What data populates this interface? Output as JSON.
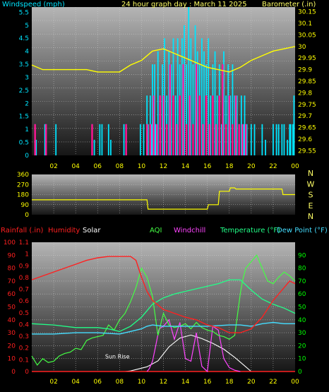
{
  "colors": {
    "wind": "#00e5ff",
    "gust": "#ff1493",
    "barometer": "#ffff00",
    "dir": "#ffff00",
    "rain": "#ff2020",
    "humidity": "#ff2020",
    "solar": "#ffffff",
    "aqi": "#44ff44",
    "windchill": "#ff44ff",
    "temperature": "#22ff88",
    "dewpoint": "#44ddff",
    "green_text": "#00ff00",
    "title_text": "#ffff66"
  },
  "header": {
    "windspeed_label": "Windspeed (mph)",
    "title": "24 hour graph day : March 11 2025",
    "barometer_label": "Barometer (.in)"
  },
  "legend": {
    "rainfall": "Rainfall (.in)",
    "humidity": "Humidity",
    "solar": "Solar",
    "aqi": "AQI",
    "windchill": "Windchill",
    "temperature": "Temperature (°F)",
    "dewpoint": "Dew Point (°F)"
  },
  "chart_data": [
    {
      "type": "bar",
      "title": "24 hour graph day : March 11 2025",
      "ylabel": "Windspeed (mph)",
      "y2label": "Barometer (.in)",
      "ylim": [
        0,
        5.7
      ],
      "y2lim": [
        29.53,
        30.17
      ],
      "x_ticks": [
        "02",
        "04",
        "06",
        "08",
        "10",
        "12",
        "14",
        "16",
        "18",
        "20",
        "22",
        "00"
      ],
      "y_ticks": [
        "0",
        "0.5",
        "1",
        "1.5",
        "2",
        "2.5",
        "3",
        "3.5",
        "4",
        "4.5",
        "5",
        "5.5"
      ],
      "y2_ticks": [
        "29.55",
        "29.6",
        "29.65",
        "29.7",
        "29.75",
        "29.8",
        "29.85",
        "29.9",
        "29.95",
        "30",
        "30.05",
        "30.1",
        "30.15"
      ],
      "series": [
        {
          "name": "Windspeed",
          "x": [
            0.3,
            0.4,
            1.2,
            1.3,
            2.2,
            5.5,
            5.7,
            6.2,
            6.4,
            7.0,
            7.2,
            8.4,
            8.6,
            9.9,
            10.2,
            10.5,
            10.6,
            10.8,
            10.9,
            11.0,
            11.2,
            11.3,
            11.5,
            11.7,
            11.9,
            12.1,
            12.3,
            12.5,
            12.7,
            12.9,
            13.1,
            13.3,
            13.5,
            13.7,
            13.9,
            14.1,
            14.3,
            14.5,
            14.7,
            14.9,
            15.1,
            15.3,
            15.5,
            15.7,
            15.9,
            16.1,
            16.3,
            16.5,
            16.7,
            16.9,
            17.1,
            17.3,
            17.5,
            17.7,
            17.9,
            18.1,
            18.3,
            18.5,
            18.7,
            18.9,
            19.1,
            19.3,
            19.4,
            19.6,
            20.0,
            20.3,
            21.0,
            21.3,
            22.0,
            22.3,
            22.5,
            22.8,
            23.0,
            23.3,
            23.5,
            23.6,
            23.8,
            23.9
          ],
          "values": [
            1.2,
            0.6,
            1.2,
            1.2,
            1.2,
            1.2,
            0.6,
            1.2,
            1.2,
            1.2,
            0.6,
            1.2,
            1.2,
            1.2,
            1.2,
            2.3,
            1.2,
            2.3,
            1.2,
            3.5,
            3.5,
            1.2,
            4.0,
            2.3,
            3.5,
            4.5,
            2.3,
            4.0,
            3.5,
            4.5,
            2.3,
            4.5,
            3.5,
            4.5,
            5.0,
            3.5,
            5.7,
            4.5,
            3.5,
            5.0,
            4.0,
            3.5,
            4.5,
            4.0,
            3.5,
            4.5,
            2.3,
            3.5,
            4.0,
            2.3,
            3.5,
            1.2,
            4.0,
            2.3,
            3.5,
            2.3,
            3.5,
            2.3,
            2.3,
            1.2,
            2.3,
            1.2,
            2.3,
            1.2,
            1.2,
            1.2,
            1.2,
            0.6,
            1.2,
            1.2,
            1.2,
            1.2,
            1.2,
            0.6,
            1.2,
            1.2,
            1.2,
            2.3
          ]
        },
        {
          "name": "Gust",
          "x": [
            0.3,
            1.3,
            5.5,
            8.6,
            10.5,
            10.8,
            11.1,
            11.4,
            11.7,
            12.0,
            12.3,
            12.6,
            12.9,
            13.2,
            13.5,
            13.8,
            14.1,
            14.4,
            14.7,
            15.0,
            15.3,
            15.6,
            15.9,
            16.2,
            16.5,
            16.8,
            17.1,
            17.4,
            17.7,
            18.0,
            18.3,
            18.6,
            18.9,
            19.2,
            19.5
          ],
          "values": [
            1.2,
            1.2,
            1.2,
            1.2,
            1.2,
            1.2,
            2.3,
            1.2,
            2.3,
            2.3,
            1.2,
            3.5,
            2.3,
            1.2,
            2.3,
            3.5,
            1.2,
            2.3,
            1.2,
            3.5,
            2.3,
            1.2,
            2.3,
            1.2,
            2.3,
            1.2,
            2.3,
            3.5,
            1.2,
            2.3,
            1.2,
            2.3,
            1.2,
            1.2,
            1.2
          ]
        },
        {
          "name": "Barometer",
          "x": [
            0,
            1,
            2,
            3,
            4,
            5,
            6,
            7,
            8,
            9,
            10,
            11,
            12,
            13,
            14,
            15,
            16,
            17,
            18,
            19,
            20,
            21,
            22,
            23,
            24
          ],
          "values": [
            29.92,
            29.9,
            29.9,
            29.9,
            29.9,
            29.9,
            29.89,
            29.89,
            29.89,
            29.92,
            29.94,
            29.98,
            29.99,
            29.97,
            29.95,
            29.93,
            29.91,
            29.9,
            29.89,
            29.91,
            29.94,
            29.96,
            29.98,
            29.99,
            30.0
          ]
        }
      ]
    },
    {
      "type": "line",
      "right_labels": [
        "N",
        "W",
        "S",
        "E",
        "N"
      ],
      "ylim": [
        0,
        360
      ],
      "y_ticks": [
        "0",
        "90",
        "180",
        "270",
        "360"
      ],
      "series": [
        {
          "name": "Wind Direction",
          "x": [
            0,
            10.5,
            10.6,
            16.0,
            16.1,
            17.0,
            17.1,
            18.0,
            18.1,
            18.5,
            18.6,
            22.8,
            22.9,
            24
          ],
          "values": [
            133,
            133,
            50,
            50,
            90,
            90,
            210,
            210,
            240,
            240,
            230,
            230,
            180,
            180
          ]
        }
      ]
    },
    {
      "type": "line",
      "x_ticks": [
        "02",
        "04",
        "06",
        "08",
        "10",
        "12",
        "14",
        "16",
        "18",
        "20",
        "22",
        "00"
      ],
      "y_ticks_rain": [
        "0",
        "0.1",
        "0.2",
        "0.3",
        "0.4",
        "0.5",
        "0.6",
        "0.7",
        "0.8",
        "0.9",
        "1",
        "1.1"
      ],
      "y_ticks_humidity": [
        "0",
        "10",
        "20",
        "30",
        "40",
        "50",
        "60",
        "70",
        "80",
        "90",
        "100"
      ],
      "y_ticks_temp": [
        "0",
        "10",
        "20",
        "30",
        "40",
        "50",
        "60",
        "70",
        "80",
        "90"
      ],
      "annotation": "Sun Rise",
      "series": [
        {
          "name": "Humidity",
          "x": [
            0,
            1,
            2,
            3,
            4,
            5,
            6,
            7,
            8,
            9,
            9.5,
            10,
            10.5,
            11,
            12,
            13,
            14,
            15,
            16,
            17,
            18,
            19,
            20,
            21,
            22,
            23,
            23.5,
            24
          ],
          "values": [
            71,
            74,
            77,
            80,
            83,
            86,
            88,
            89,
            89,
            89,
            86,
            73,
            62,
            55,
            48,
            45,
            42,
            40,
            36,
            34,
            30,
            30,
            33,
            42,
            55,
            65,
            70,
            68
          ]
        },
        {
          "name": "Temperature",
          "x": [
            0,
            2,
            4,
            6,
            7,
            8,
            9,
            10,
            11,
            12,
            13,
            14,
            15,
            16,
            17,
            18,
            19,
            19.5,
            20,
            21,
            22,
            23,
            24
          ],
          "values": [
            37,
            36,
            34,
            34,
            33,
            31,
            35,
            42,
            52,
            57,
            60,
            62,
            64,
            66,
            68,
            71,
            71,
            67,
            63,
            56,
            52,
            49,
            45
          ]
        },
        {
          "name": "Dew Point",
          "x": [
            0,
            2,
            4,
            6,
            8,
            9,
            10,
            10.5,
            11,
            12,
            14,
            16,
            18,
            19,
            20,
            21,
            22,
            23,
            24
          ],
          "values": [
            29,
            29,
            30,
            30,
            29,
            31,
            33,
            35,
            36,
            35,
            35,
            35,
            36,
            36,
            35,
            37,
            38,
            37,
            37
          ]
        },
        {
          "name": "AQI",
          "x": [
            0,
            0.5,
            1,
            1.5,
            2,
            2.5,
            3,
            3.5,
            4,
            4.5,
            5,
            5.5,
            6,
            6.5,
            7,
            7.5,
            8,
            8.5,
            9,
            9.5,
            10,
            10.5,
            11,
            11.5,
            12,
            12.5,
            13,
            13.5,
            14,
            14.5,
            15,
            15.5,
            16,
            16.5,
            17,
            17.5,
            18,
            18.5,
            19,
            19.2,
            19.5,
            20,
            20.5,
            21,
            21.5,
            22,
            22.5,
            23,
            23.5,
            24
          ],
          "values": [
            12,
            5,
            10,
            7,
            8,
            12,
            14,
            15,
            18,
            17,
            24,
            26,
            27,
            28,
            36,
            32,
            40,
            45,
            54,
            65,
            80,
            73,
            58,
            28,
            45,
            36,
            34,
            35,
            37,
            33,
            38,
            34,
            32,
            31,
            28,
            27,
            25,
            28,
            60,
            70,
            80,
            85,
            90,
            80,
            70,
            68,
            73,
            77,
            74,
            70
          ]
        },
        {
          "name": "Windchill",
          "x": [
            10.5,
            10.7,
            11.0,
            11.3,
            11.6,
            12.0,
            12.5,
            13.0,
            13.5,
            14.0,
            14.5,
            15.0,
            15.5,
            16.0,
            16.5,
            17.0,
            17.5,
            18.0,
            18.5,
            19.0
          ],
          "values": [
            0,
            2,
            8,
            20,
            33,
            35,
            40,
            25,
            38,
            10,
            8,
            30,
            4,
            0,
            35,
            32,
            10,
            3,
            1,
            0
          ]
        },
        {
          "name": "Solar",
          "x": [
            0,
            8.5,
            9.0,
            10.5,
            11.5,
            12.5,
            13.5,
            14.5,
            15.5,
            16.5,
            17.5,
            18.5,
            19.5,
            20.0,
            24
          ],
          "values": [
            0,
            0,
            5,
            40,
            90,
            210,
            285,
            310,
            280,
            240,
            190,
            120,
            40,
            0,
            0
          ]
        },
        {
          "name": "Rainfall",
          "x": [
            0,
            24
          ],
          "values": [
            0,
            0
          ]
        }
      ]
    }
  ]
}
